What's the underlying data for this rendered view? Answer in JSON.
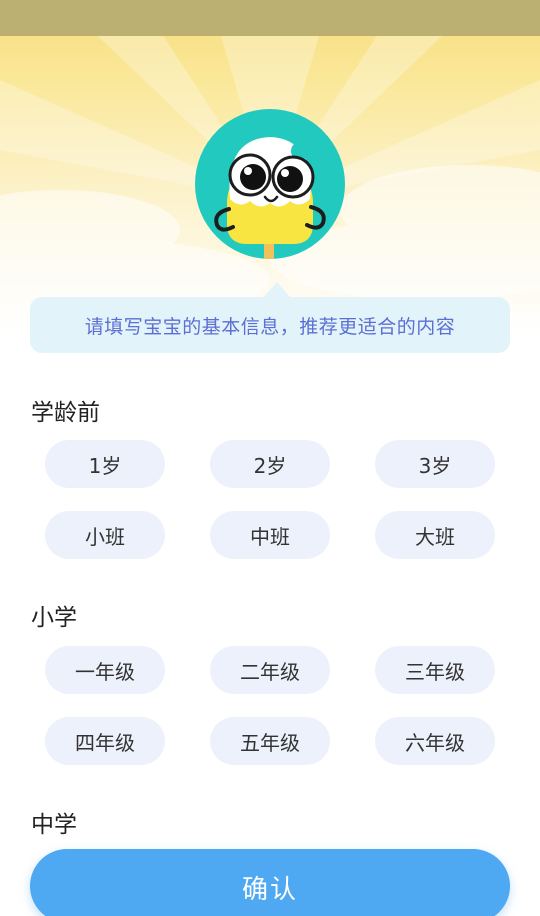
{
  "tip": {
    "text": "请填写宝宝的基本信息，推荐更适合的内容"
  },
  "sections": [
    {
      "title": "学龄前",
      "options": [
        "1岁",
        "2岁",
        "3岁",
        "小班",
        "中班",
        "大班"
      ]
    },
    {
      "title": "小学",
      "options": [
        "一年级",
        "二年级",
        "三年级",
        "四年级",
        "五年级",
        "六年级"
      ]
    },
    {
      "title": "中学",
      "options": []
    }
  ],
  "confirm": {
    "label": "确认"
  },
  "colors": {
    "accent": "#4ea8f2",
    "chip_bg": "#edf1fc",
    "tip_bg": "#e3f3fa",
    "tip_text": "#5b6fd4",
    "mascot_bg": "#22c9bf"
  },
  "mascot": {
    "icon": "ice-cream-mascot-icon"
  }
}
